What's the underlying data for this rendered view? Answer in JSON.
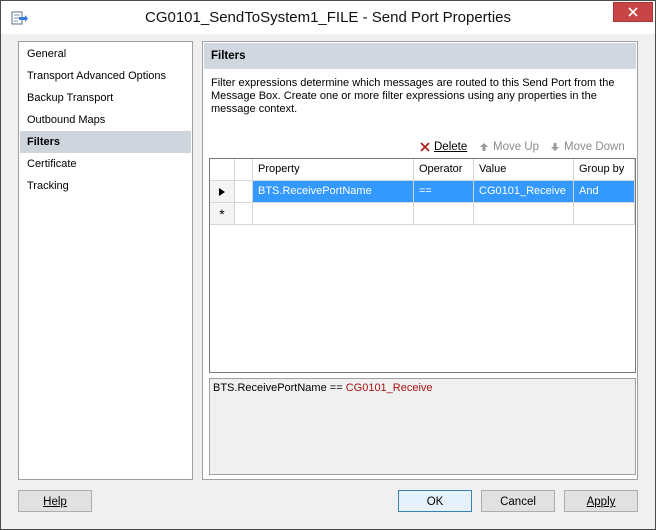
{
  "window": {
    "title": "CG0101_SendToSystem1_FILE - Send Port Properties"
  },
  "nav": {
    "items": [
      {
        "label": "General",
        "selected": false
      },
      {
        "label": "Transport Advanced Options",
        "selected": false
      },
      {
        "label": "Backup Transport",
        "selected": false
      },
      {
        "label": "Outbound Maps",
        "selected": false
      },
      {
        "label": "Filters",
        "selected": true
      },
      {
        "label": "Certificate",
        "selected": false
      },
      {
        "label": "Tracking",
        "selected": false
      }
    ]
  },
  "filters": {
    "header": "Filters",
    "description": "Filter expressions determine which messages are routed to this Send Port from the Message Box. Create one or more filter expressions using any properties in the message context.",
    "toolbar": {
      "delete_label": "Delete",
      "move_up_label": "Move Up",
      "move_down_label": "Move Down"
    },
    "columns": [
      "Property",
      "Operator",
      "Value",
      "Group by"
    ],
    "rows": [
      {
        "property": "BTS.ReceivePortName",
        "operator": "==",
        "value": "CG0101_Receive",
        "group_by": "And"
      }
    ],
    "new_row_marker": "*",
    "preview": {
      "property": "BTS.ReceivePortName",
      "operator": "==",
      "value": "CG0101_Receive"
    }
  },
  "buttons": {
    "help": "Help",
    "ok": "OK",
    "cancel": "Cancel",
    "apply": "Apply"
  },
  "colors": {
    "selection": "#3399ff",
    "nav_selected": "#cfd5dc",
    "section_header": "#d1d7de",
    "preview_value": "#a31515",
    "close_button": "#c74545"
  }
}
